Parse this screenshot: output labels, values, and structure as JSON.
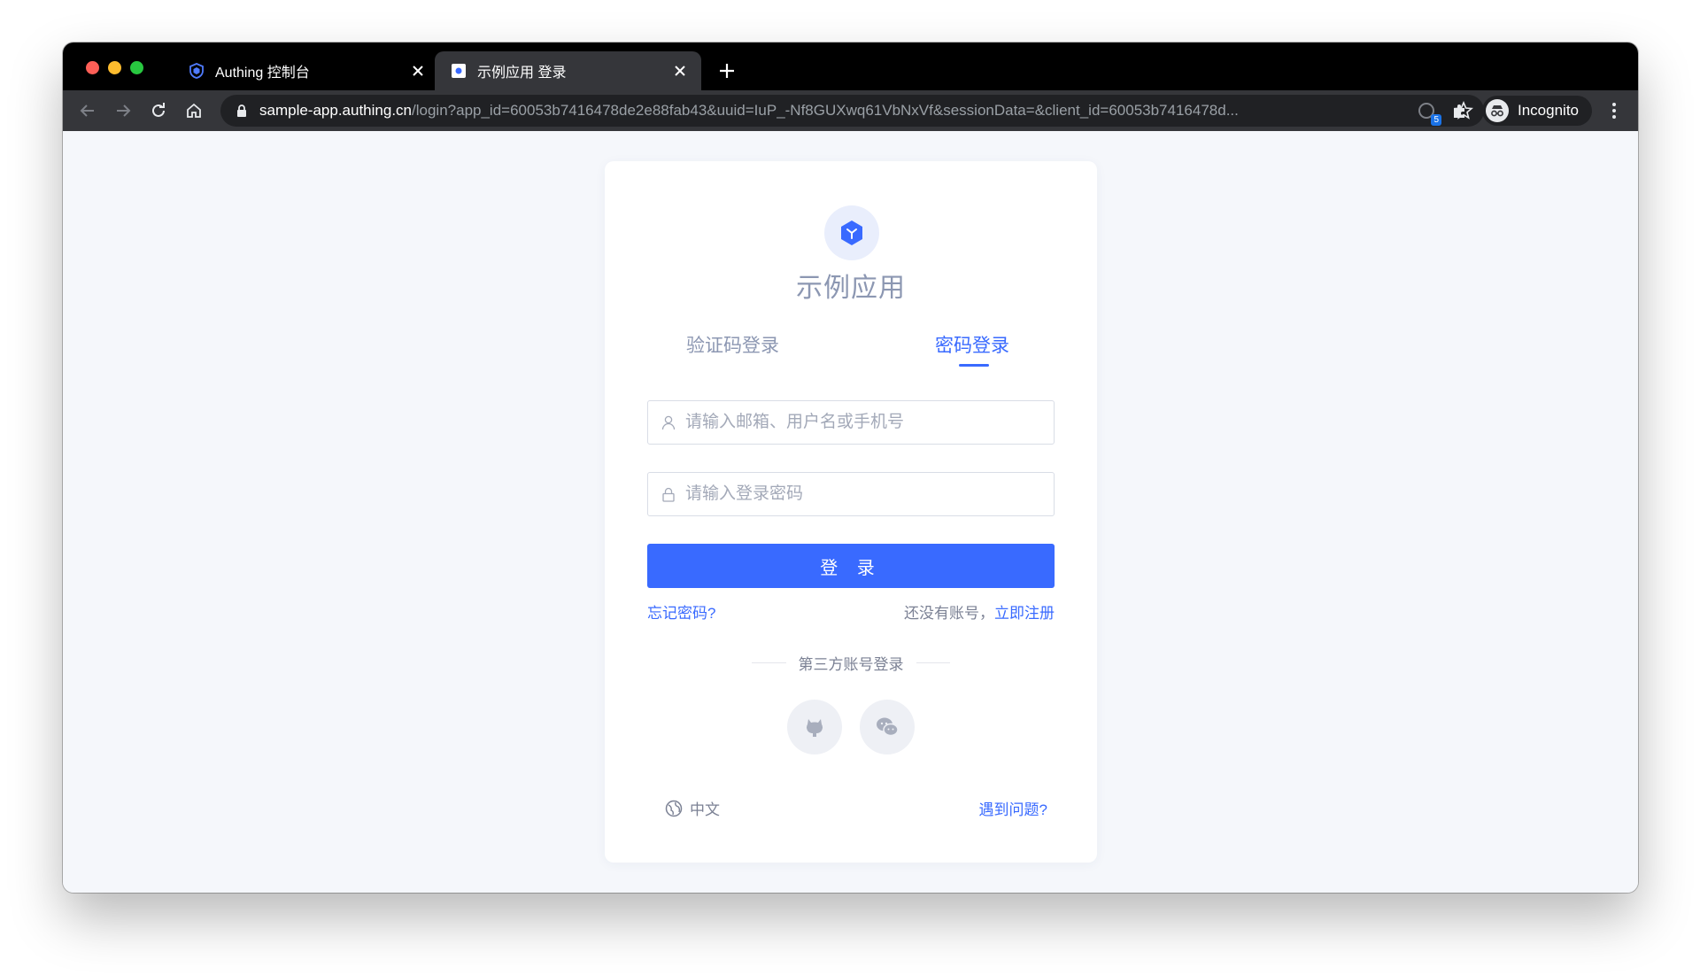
{
  "browser": {
    "tabs": [
      {
        "title": "Authing 控制台",
        "active": false
      },
      {
        "title": "示例应用 登录",
        "active": true
      }
    ],
    "url_host": "sample-app.authing.cn",
    "url_path": "/login?app_id=60053b7416478de2e88fab43&uuid=IuP_-Nf8GUXwq61VbNxVf&sessionData=&client_id=60053b7416478d...",
    "extension_badge": "5",
    "profile_label": "Incognito"
  },
  "login": {
    "app_name": "示例应用",
    "tab_code": "验证码登录",
    "tab_password": "密码登录",
    "username_placeholder": "请输入邮箱、用户名或手机号",
    "password_placeholder": "请输入登录密码",
    "login_button": "登 录",
    "forgot_password": "忘记密码?",
    "no_account": "还没有账号，",
    "register": "立即注册",
    "third_party": "第三方账号登录",
    "social": [
      "github-icon",
      "wechat-icon"
    ],
    "language": "中文",
    "help": "遇到问题?"
  },
  "colors": {
    "accent": "#396aff",
    "muted_text": "#8c97b2",
    "page_bg": "#f5f7fb"
  }
}
